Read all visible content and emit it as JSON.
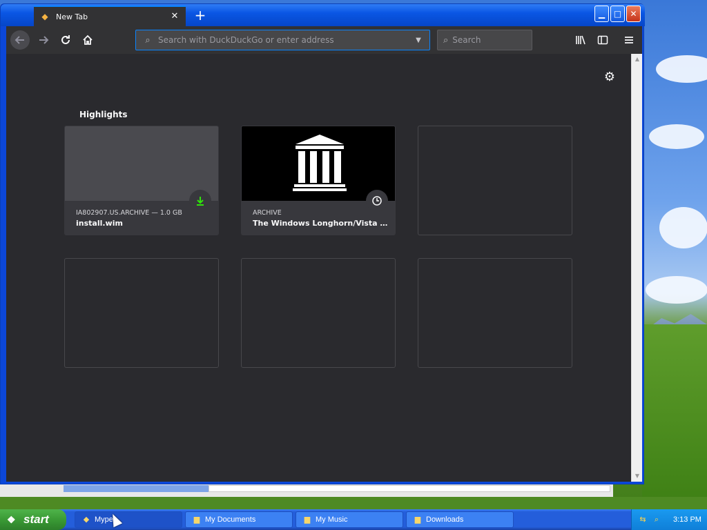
{
  "browser": {
    "tab": {
      "title": "New Tab",
      "icon": "firefox-icon"
    },
    "url_placeholder": "Search with DuckDuckGo or enter address",
    "search_placeholder": "Search",
    "icons": [
      "back-icon",
      "forward-icon",
      "reload-icon",
      "home-icon",
      "library-icon",
      "sidebar-icon",
      "menu-icon",
      "settings-gear-icon"
    ]
  },
  "page": {
    "highlights_title": "Highlights",
    "cards": [
      {
        "meta": "IA802907.US.ARCHIVE — 1.0 GB",
        "name": "install.wim",
        "badge": "download-icon"
      },
      {
        "meta": "ARCHIVE",
        "name": "The Windows Longhorn/Vista A...",
        "badge": "history-icon"
      }
    ]
  },
  "taskbar": {
    "start_label": "start",
    "items": [
      {
        "label": "Mype",
        "icon": "firefox-icon"
      },
      {
        "label": "My Documents",
        "icon": "folder-icon"
      },
      {
        "label": "My Music",
        "icon": "folder-icon"
      },
      {
        "label": "Downloads",
        "icon": "folder-icon"
      }
    ],
    "clock": "3:13 PM"
  },
  "colors": {
    "accent": "#0a84ff",
    "download_green": "#30e60b",
    "content_bg": "#2a2a2e"
  }
}
